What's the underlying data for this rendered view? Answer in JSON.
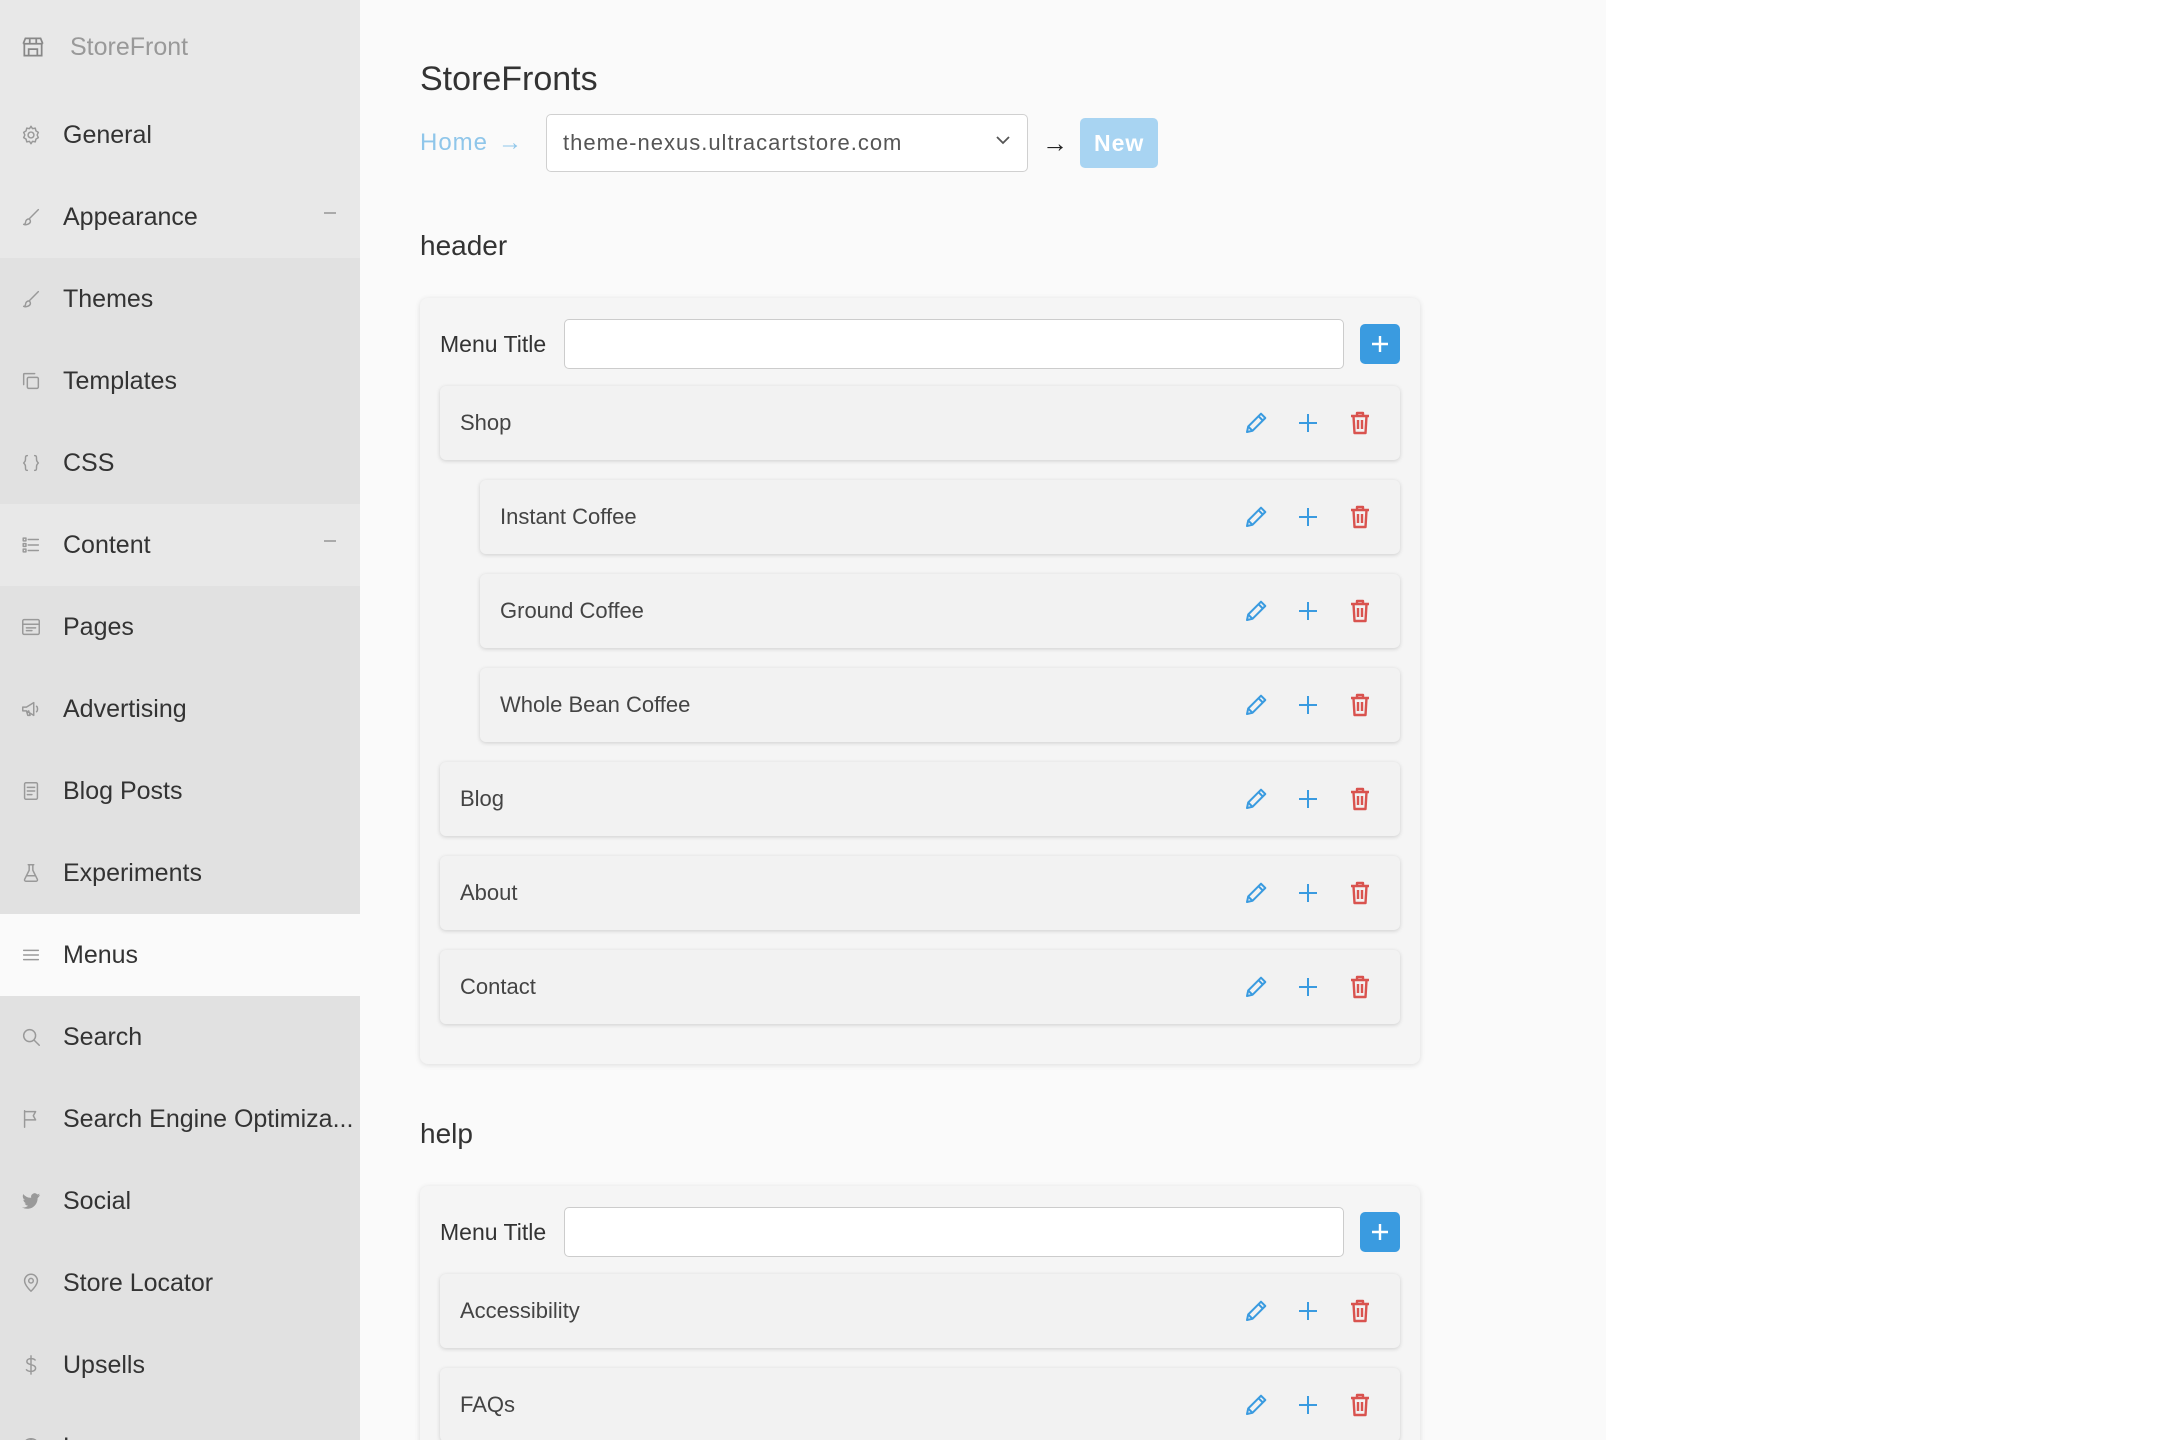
{
  "sidebar": {
    "brand": "StoreFront",
    "items": [
      {
        "label": "General",
        "icon": "gear-icon",
        "level": "parent"
      },
      {
        "label": "Appearance",
        "icon": "brush-icon",
        "level": "parent",
        "expanded": true
      },
      {
        "label": "Themes",
        "icon": "brush-icon",
        "level": "child"
      },
      {
        "label": "Templates",
        "icon": "copy-icon",
        "level": "child"
      },
      {
        "label": "CSS",
        "icon": "braces-icon",
        "level": "child"
      },
      {
        "label": "Content",
        "icon": "list-icon",
        "level": "parent",
        "expanded": true
      },
      {
        "label": "Pages",
        "icon": "window-icon",
        "level": "child"
      },
      {
        "label": "Advertising",
        "icon": "megaphone-icon",
        "level": "child"
      },
      {
        "label": "Blog Posts",
        "icon": "document-icon",
        "level": "child"
      },
      {
        "label": "Experiments",
        "icon": "flask-icon",
        "level": "child"
      },
      {
        "label": "Menus",
        "icon": "menu-lines-icon",
        "level": "child",
        "active": true
      },
      {
        "label": "Search",
        "icon": "search-icon",
        "level": "child"
      },
      {
        "label": "Search Engine Optimiza...",
        "icon": "flag-icon",
        "level": "child"
      },
      {
        "label": "Social",
        "icon": "twitter-icon",
        "level": "child"
      },
      {
        "label": "Store Locator",
        "icon": "map-pin-icon",
        "level": "child"
      },
      {
        "label": "Upsells",
        "icon": "dollar-icon",
        "level": "child"
      },
      {
        "label": "Languages",
        "icon": "globe-icon",
        "level": "child"
      }
    ]
  },
  "main": {
    "title": "StoreFronts",
    "breadcrumb": {
      "home": "Home",
      "arrow": "→",
      "store": "theme-nexus.ultracartstore.com",
      "arrow2": "→",
      "new_label": "New"
    },
    "sections": [
      {
        "name": "header",
        "menu_title_label": "Menu Title",
        "menu_title_value": "",
        "items": [
          {
            "label": "Shop",
            "indent": false
          },
          {
            "label": "Instant Coffee",
            "indent": true
          },
          {
            "label": "Ground Coffee",
            "indent": true
          },
          {
            "label": "Whole Bean Coffee",
            "indent": true
          },
          {
            "label": "Blog",
            "indent": false
          },
          {
            "label": "About",
            "indent": false
          },
          {
            "label": "Contact",
            "indent": false
          }
        ]
      },
      {
        "name": "help",
        "menu_title_label": "Menu Title",
        "menu_title_value": "",
        "items": [
          {
            "label": "Accessibility",
            "indent": false
          },
          {
            "label": "FAQs",
            "indent": false
          }
        ]
      }
    ]
  },
  "colors": {
    "accent": "#3a9be0",
    "link": "#8fc6ea",
    "delete": "#d9534f",
    "sidebar_bg": "#e8e8e8",
    "active_bg": "#fafafa"
  }
}
